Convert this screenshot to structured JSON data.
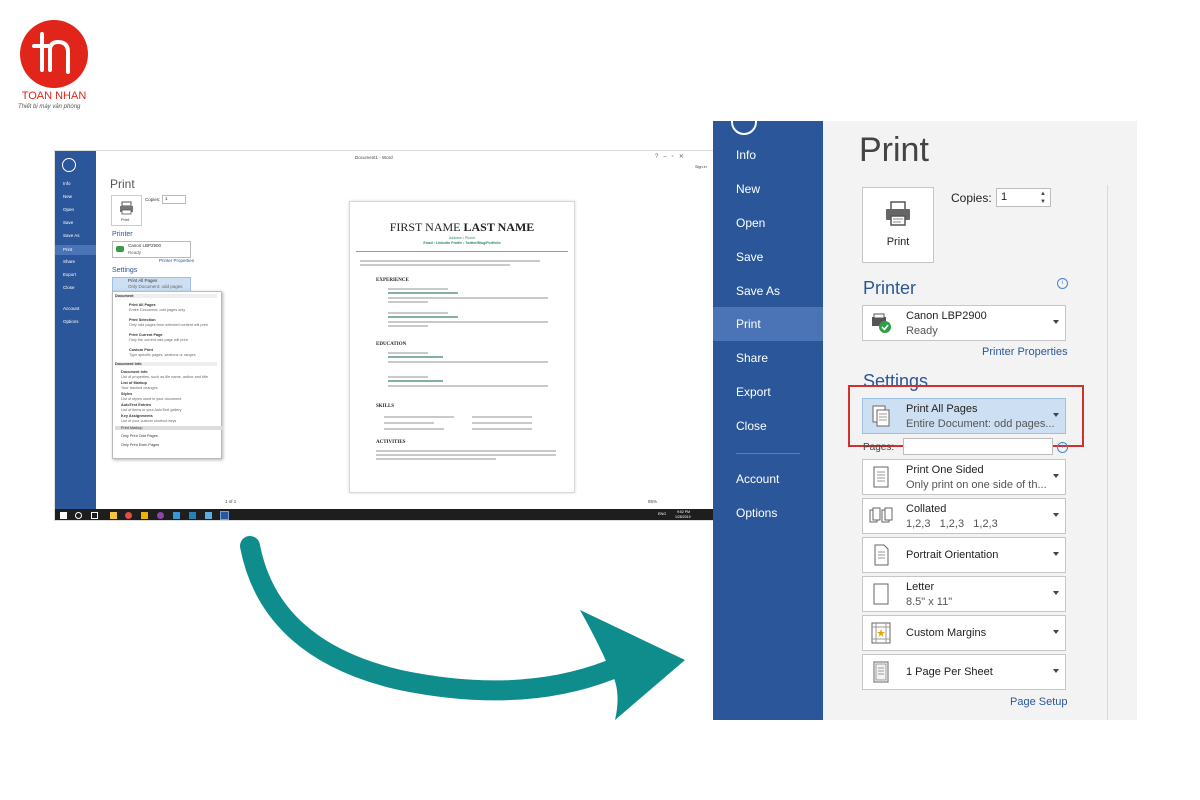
{
  "logo": {
    "name": "TOAN NHAN",
    "tagline": "Thiết bị máy văn phòng",
    "letters": "tn"
  },
  "small_shot": {
    "window_title": "Document1 - Word",
    "sign_in": "Sign in",
    "rail": [
      "Info",
      "New",
      "Open",
      "Save",
      "Save As",
      "Print",
      "Share",
      "Export",
      "Close",
      "Account",
      "Options"
    ],
    "print_heading": "Print",
    "copies_label": "Copies:",
    "copies_value": "1",
    "print_button": "Print",
    "printer_heading": "Printer",
    "printer_name": "Canon LBP2900",
    "printer_status": "Ready",
    "printer_properties": "Printer Properties",
    "settings_heading": "Settings",
    "selected_setting_1": "Print All Pages",
    "selected_setting_2": "Only Document: odd pages",
    "dropdown": {
      "document_header": "Document",
      "items": [
        {
          "title": "Print All Pages",
          "desc": "Entire Document: odd pages only"
        },
        {
          "title": "Print Selection",
          "desc": "Only odd pages from selected content will print"
        },
        {
          "title": "Print Current Page",
          "desc": "Only the current odd page will print"
        },
        {
          "title": "Custom Print",
          "desc": "Type specific pages, sections or ranges"
        }
      ],
      "docinfo_header": "Document Info",
      "docinfo_items": [
        {
          "title": "Document Info",
          "desc": "List of properties, such as file name, author and title"
        },
        {
          "title": "List of Markup",
          "desc": "Your tracked changes"
        },
        {
          "title": "Styles",
          "desc": "List of styles used in your document"
        },
        {
          "title": "AutoText Entries",
          "desc": "List of items in your AutoText gallery"
        },
        {
          "title": "Key Assignments",
          "desc": "List of your custom shortcut keys"
        }
      ],
      "print_markup": "Print Markup",
      "only_odd": "Only Print Odd Pages",
      "only_even": "Only Print Even Pages"
    },
    "page": {
      "first": "FIRST NAME",
      "last": "LAST NAME",
      "address": "Address • Phone",
      "contact": "Email • LinkedIn Profile • Twitter/Blog/Portfolio",
      "sections": [
        "EXPERIENCE",
        "EDUCATION",
        "SKILLS",
        "ACTIVITIES"
      ]
    },
    "page_nav": "1  of 1",
    "zoom": "85%",
    "clock_time": "9:52 PM",
    "clock_date": "1/28/2019",
    "lang": "ENG"
  },
  "rail": {
    "items": [
      {
        "label": "Info"
      },
      {
        "label": "New"
      },
      {
        "label": "Open"
      },
      {
        "label": "Save"
      },
      {
        "label": "Save As"
      },
      {
        "label": "Print",
        "selected": true
      },
      {
        "label": "Share"
      },
      {
        "label": "Export"
      },
      {
        "label": "Close"
      }
    ],
    "bottom": [
      {
        "label": "Account"
      },
      {
        "label": "Options"
      }
    ]
  },
  "print": {
    "title": "Print",
    "print_button_label": "Print",
    "copies_label": "Copies:",
    "copies_value": "1"
  },
  "printer": {
    "heading": "Printer",
    "name": "Canon LBP2900",
    "status": "Ready",
    "properties_link": "Printer Properties"
  },
  "settings": {
    "heading": "Settings",
    "pages_label": "Pages:",
    "pages_value": "",
    "combos": [
      {
        "key": "print-all-pages",
        "line1": "Print All Pages",
        "line2": "Entire Document: odd pages...",
        "highlighted": true
      },
      {
        "key": "print-one-sided",
        "line1": "Print One Sided",
        "line2": "Only print on one side of th..."
      },
      {
        "key": "collated",
        "line1": "Collated",
        "line2": "1,2,3   1,2,3   1,2,3"
      },
      {
        "key": "orientation",
        "line1": "Portrait Orientation",
        "line2": ""
      },
      {
        "key": "paper-size",
        "line1": "Letter",
        "line2": "8.5\" x 11\""
      },
      {
        "key": "margins",
        "line1": "Custom Margins",
        "line2": ""
      },
      {
        "key": "pages-per-sheet",
        "line1": "1 Page Per Sheet",
        "line2": ""
      }
    ],
    "page_setup_link": "Page Setup"
  },
  "colors": {
    "word_blue": "#2b579a",
    "rail_selected": "#4a74b5",
    "highlight": "#cddff2",
    "callout_red": "#d0312d",
    "arrow_teal": "#0f8c8c",
    "logo_red": "#e1251b"
  }
}
